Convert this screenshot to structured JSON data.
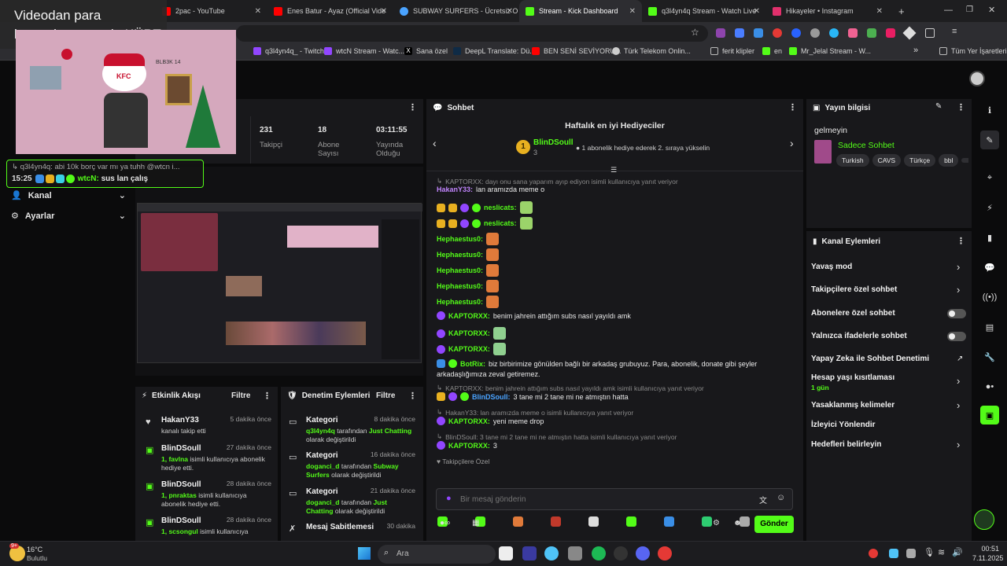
{
  "browser": {
    "tabs": [
      {
        "label": "2pac - YouTube",
        "color": "#ff0000"
      },
      {
        "label": "Enes Batur - Ayaz (Official Vide",
        "color": "#ff0000"
      },
      {
        "label": "SUBWAY SURFERS - Ücretsiz O",
        "color": "#4aa3ff"
      },
      {
        "label": "Stream - Kick Dashboard",
        "color": "#53fc18"
      },
      {
        "label": "q3l4yn4q Stream - Watch Live",
        "color": "#53fc18"
      },
      {
        "label": "Hikayeler • Instagram",
        "color": "#e1306c"
      }
    ],
    "new_tab": "+",
    "bookmarks": [
      {
        "label": "q3l4yn4q_ - Twitch",
        "color": "#9146ff"
      },
      {
        "label": "wtcN Stream - Watc...",
        "color": "#9146ff"
      },
      {
        "label": "Sana özel",
        "color": "#ffffff"
      },
      {
        "label": "DeepL Translate: Dü...",
        "color": "#0f2b46"
      },
      {
        "label": "BEN SENİ SEVİYORU...",
        "color": "#ff0000"
      },
      {
        "label": "Türk Telekom Onlin...",
        "color": "#cccccc"
      },
      {
        "label": "ferit klipler",
        "color": "#888888"
      },
      {
        "label": "en",
        "color": "#53fc18"
      },
      {
        "label": "Mr_Jelal Stream - W...",
        "color": "#53fc18"
      }
    ],
    "bookmarks_more": "»",
    "all_bookmarks": "Tüm Yer İşaretleri"
  },
  "overlay": {
    "title_line1": "Videodan para",
    "title_line2": "kazanılamayacak: KÜRT",
    "webcam_text": "KFC",
    "webcam_caption": "BLB3K 14",
    "chat_line1": "q3l4yn4q: abi 10k borç var mı ya tuhh @wtcn i...",
    "chat_time": "15:25",
    "chat_user": "wtcN:",
    "chat_msg": "sus lan çalış"
  },
  "left_nav": {
    "items": [
      {
        "label": "Kanal",
        "icon": "user-icon"
      },
      {
        "label": "Ayarlar",
        "icon": "gear-icon"
      }
    ],
    "fragment": "esi"
  },
  "stats": [
    {
      "value": "231",
      "label": "Takipçi"
    },
    {
      "value": "18",
      "label": "Abone Sayısı"
    },
    {
      "value": "03:11:55",
      "label": "Yayında Olduğu"
    }
  ],
  "activity": {
    "title": "Etkinlik Akışı",
    "filter": "Filtre",
    "items": [
      {
        "user": "HakanY33",
        "time": "5 dakika önce",
        "desc": "kanalı takip etti",
        "highlight": "",
        "icon": "heart-icon"
      },
      {
        "user": "BlinDSoull",
        "time": "27 dakika önce",
        "desc": "isimli kullanıcıya abonelik hediye etti.",
        "highlight": "1, favlna",
        "icon": "gift-icon"
      },
      {
        "user": "BlinDSoull",
        "time": "28 dakika önce",
        "desc": "isimli kullanıcıya abonelik hediye etti.",
        "highlight": "1, pnraktas",
        "icon": "gift-icon"
      },
      {
        "user": "BlinDSoull",
        "time": "28 dakika önce",
        "desc": "isimli kullanıcıya",
        "highlight": "1, scsongul",
        "icon": "gift-icon"
      }
    ]
  },
  "moderation": {
    "title": "Denetim Eylemleri",
    "filter": "Filtre",
    "items": [
      {
        "title": "Kategori",
        "time": "8 dakika önce",
        "actor": "q3l4yn4q",
        "mid": " tarafından ",
        "target": "Just Chatting",
        "suffix": " olarak değiştirildi"
      },
      {
        "title": "Kategori",
        "time": "16 dakika önce",
        "actor": "doganci_d",
        "mid": " tarafından ",
        "target": "Subway Surfers",
        "suffix": " olarak değiştirildi"
      },
      {
        "title": "Kategori",
        "time": "21 dakika önce",
        "actor": "doganci_d",
        "mid": " tarafından ",
        "target": "Just Chatting",
        "suffix": " olarak değiştirildi"
      },
      {
        "title": "Mesaj Sabitlemesi",
        "time": "30 dakika",
        "actor": "",
        "mid": "",
        "target": "",
        "suffix": ""
      }
    ]
  },
  "chat": {
    "title": "Sohbet",
    "gifters_title": "Haftalık en iyi Hediyeciler",
    "top_gifter": "BlinDSoull",
    "top_gifter_count": "3",
    "top_gifter_rank": "1",
    "gifter_note": "1 abonelik hediye ederek 2. sıraya yükselin",
    "lines": [
      {
        "type": "reply",
        "text": "KAPTORXX: dayı onu sana yaparım ayıp ediyon isimli kullanıcıya yanıt veriyor"
      },
      {
        "type": "msg",
        "user": "HakanY33",
        "text": "lan aramızda meme o",
        "color": "#c084fc"
      },
      {
        "type": "emote",
        "user": "neslicats",
        "badges": 4
      },
      {
        "type": "emote",
        "user": "neslicats",
        "badges": 4
      },
      {
        "type": "emote",
        "user": "Hephaestus0",
        "badges": 0
      },
      {
        "type": "emote",
        "user": "Hephaestus0",
        "badges": 0
      },
      {
        "type": "emote",
        "user": "Hephaestus0",
        "badges": 0
      },
      {
        "type": "emote",
        "user": "Hephaestus0",
        "badges": 0
      },
      {
        "type": "emote",
        "user": "Hephaestus0",
        "badges": 0
      },
      {
        "type": "msg",
        "user": "KAPTORXX",
        "text": "benim jahrein attığım subs nasıl yayıldı amk",
        "color": "#53fc18",
        "badges": 1
      },
      {
        "type": "emote",
        "user": "KAPTORXX",
        "badges": 1
      },
      {
        "type": "emote",
        "user": "KAPTORXX",
        "badges": 1
      },
      {
        "type": "msg2",
        "user": "BotRix",
        "text": "biz birbirimize gönülden bağlı bir arkadaş grubuyuz. Para, abonelik, donate gibi şeyler",
        "text2": "arkadaşlığımıza zeval getiremez.",
        "badges": 2
      },
      {
        "type": "reply",
        "text": "KAPTORXX: benim jahrein attığım subs nasıl yayıldı amk isimli kullanıcıya yanıt veriyor"
      },
      {
        "type": "msg",
        "user": "BlinDSoull",
        "text": "3 tane mi 2 tane mi ne atmıştın hatta",
        "color": "#4aa3ff",
        "badges": 3
      },
      {
        "type": "reply",
        "text": "HakanY33: lan aramızda meme o isimli kullanıcıya yanıt veriyor"
      },
      {
        "type": "msg",
        "user": "KAPTORXX",
        "text": "yeni meme drop",
        "color": "#53fc18",
        "badges": 1
      },
      {
        "type": "reply",
        "text": "BlinDSoull: 3 tane mi 2 tane mi ne atmıştın hatta isimli kullanıcıya yanıt veriyor"
      },
      {
        "type": "msg",
        "user": "KAPTORXX",
        "text": "3",
        "color": "#53fc18",
        "badges": 1
      }
    ],
    "followers_only": "Takipçilere Özel",
    "input_placeholder": "Bir mesaj gönderin",
    "send": "Gönder"
  },
  "stream_info": {
    "title": "Yayın bilgisi",
    "stream_title": "gelmeyin",
    "category": "Sadece Sohbet",
    "tags": [
      "Turkish",
      "CAVS",
      "Türkçe",
      "bbl"
    ]
  },
  "channel_actions": {
    "title": "Kanal Eylemleri",
    "items": [
      {
        "label": "Yavaş mod",
        "control": "chevron",
        "sub": ""
      },
      {
        "label": "Takipçilere özel sohbet",
        "control": "chevron",
        "sub": ""
      },
      {
        "label": "Abonelere özel sohbet",
        "control": "toggle",
        "sub": ""
      },
      {
        "label": "Yalnızca ifadelerle sohbet",
        "control": "toggle",
        "sub": ""
      },
      {
        "label": "Yapay Zeka ile Sohbet Denetimi",
        "control": "external",
        "sub": ""
      },
      {
        "label": "Hesap yaşı kısıtlaması",
        "control": "chevron",
        "sub": "1 gün"
      },
      {
        "label": "Yasaklanmış kelimeler",
        "control": "chevron",
        "sub": ""
      },
      {
        "label": "İzleyici Yönlendir",
        "control": "none",
        "sub": ""
      },
      {
        "label": "Hedefleri belirleyin",
        "control": "chevron",
        "sub": ""
      }
    ]
  },
  "taskbar": {
    "weather_temp": "16°C",
    "weather_desc": "Bulutlu",
    "weather_badge": "9+",
    "search": "Ara",
    "time": "00:51",
    "date": "7.11.2025"
  },
  "colors": {
    "accent": "#53fc18",
    "panel": "#18181b",
    "bg": "#0b0b0c"
  }
}
